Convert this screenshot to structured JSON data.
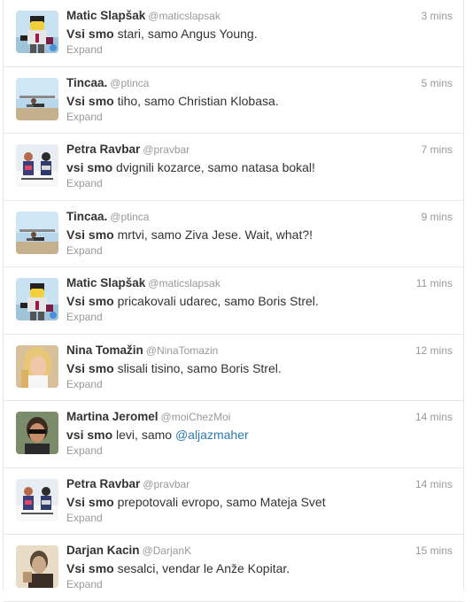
{
  "tweets": [
    {
      "name": "Matic Slapšak",
      "handle": "@maticslapsak",
      "time": "3 mins",
      "bold": "Vsi smo",
      "rest": " stari, samo Angus Young.",
      "mention": "",
      "expand": "Expand",
      "avatar": "lego-avatar"
    },
    {
      "name": "Tincaa.",
      "handle": "@ptinca",
      "time": "5 mins",
      "bold": "Vsi smo",
      "rest": " tiho, samo Christian Klobasa.",
      "mention": "",
      "expand": "Expand",
      "avatar": "beach-avatar"
    },
    {
      "name": "Petra Ravbar",
      "handle": "@pravbar",
      "time": "7 mins",
      "bold": "vsi smo",
      "rest": " dvignili kozarce, samo natasa bokal!",
      "mention": "",
      "expand": "Expand",
      "avatar": "ski-avatar"
    },
    {
      "name": "Tincaa.",
      "handle": "@ptinca",
      "time": "9 mins",
      "bold": "Vsi smo",
      "rest": " mrtvi, samo Ziva Jese. Wait, what?!",
      "mention": "",
      "expand": "Expand",
      "avatar": "beach-avatar"
    },
    {
      "name": "Matic Slapšak",
      "handle": "@maticslapsak",
      "time": "11 mins",
      "bold": "Vsi smo",
      "rest": " pricakovali udarec, samo Boris Strel.",
      "mention": "",
      "expand": "Expand",
      "avatar": "lego-avatar"
    },
    {
      "name": "Nina Tomažin",
      "handle": "@NinaTomazin",
      "time": "12 mins",
      "bold": "Vsi smo",
      "rest": " slisali tisino, samo Boris Strel.",
      "mention": "",
      "expand": "Expand",
      "avatar": "blonde-avatar"
    },
    {
      "name": "Martina Jeromel",
      "handle": "@moiChezMoi",
      "time": "14 mins",
      "bold": "vsi smo",
      "rest": " levi, samo ",
      "mention": "@aljazmaher",
      "expand": "Expand",
      "avatar": "sunglasses-avatar"
    },
    {
      "name": "Petra Ravbar",
      "handle": "@pravbar",
      "time": "14 mins",
      "bold": "Vsi smo",
      "rest": " prepotovali evropo, samo Mateja Svet",
      "mention": "",
      "expand": "Expand",
      "avatar": "ski-avatar"
    },
    {
      "name": "Darjan Kacin",
      "handle": "@DarjanK",
      "time": "15 mins",
      "bold": "Vsi smo",
      "rest": " sesalci, vendar le Anže Kopitar.",
      "mention": "",
      "expand": "Expand",
      "avatar": "sepia-avatar"
    }
  ]
}
